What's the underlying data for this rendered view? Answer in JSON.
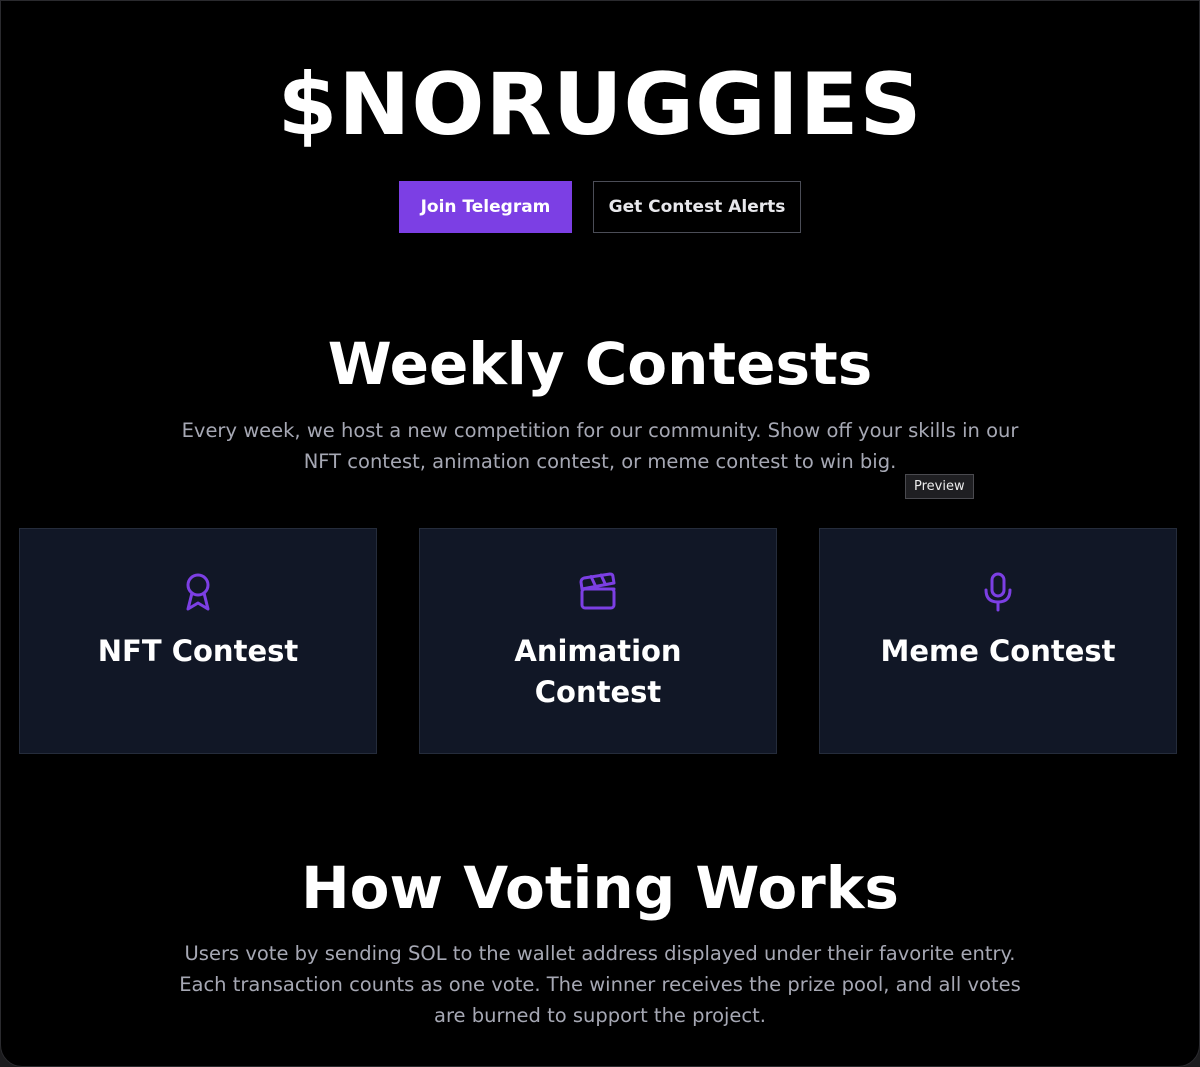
{
  "hero": {
    "title": "$NORUGGIES",
    "primary_button": "Join Telegram",
    "secondary_button": "Get Contest Alerts"
  },
  "contests_section": {
    "title": "Weekly Contests",
    "description": "Every week, we host a new competition for our community. Show off your skills in our NFT contest, animation contest, or meme contest to win big.",
    "tooltip": "Preview",
    "cards": [
      {
        "icon": "award-ribbon-icon",
        "title": "NFT Contest"
      },
      {
        "icon": "clapperboard-icon",
        "title": "Animation Contest"
      },
      {
        "icon": "microphone-icon",
        "title": "Meme Contest"
      }
    ]
  },
  "voting_section": {
    "title": "How Voting Works",
    "description": "Users vote by sending SOL to the wallet address displayed under their favorite entry. Each transaction counts as one vote. The winner receives the prize pool, and all votes are burned to support the project."
  },
  "colors": {
    "background": "#000000",
    "accent": "#7c3fe4",
    "card_background": "#111726",
    "muted_text": "#a6a8b4"
  }
}
